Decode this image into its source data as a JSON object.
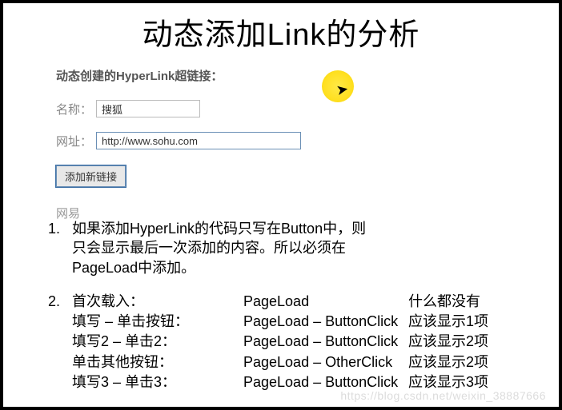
{
  "title": "动态添加Link的分析",
  "form": {
    "heading": "动态创建的HyperLink超链接：",
    "name_label": "名称：",
    "name_value": "搜狐",
    "url_label": "网址：",
    "url_value": "http://www.sohu.com",
    "add_button": "添加新链接",
    "existing_link": "网易"
  },
  "notes": {
    "item1_num": "1.",
    "item1_text": "如果添加HyperLink的代码只写在Button中，则只会显示最后一次添加的内容。所以必须在PageLoad中添加。",
    "item2_num": "2.",
    "item2_intro": "首次载入：",
    "rows": [
      {
        "action": "首次载入：",
        "events": "PageLoad",
        "result": "什么都没有"
      },
      {
        "action": "填写 – 单击按钮：",
        "events": "PageLoad – ButtonClick",
        "result": "应该显示1项"
      },
      {
        "action": "填写2 – 单击2：",
        "events": "PageLoad – ButtonClick",
        "result": "应该显示2项"
      },
      {
        "action": "单击其他按钮：",
        "events": "PageLoad – OtherClick",
        "result": "应该显示2项"
      },
      {
        "action": "填写3 – 单击3：",
        "events": "PageLoad – ButtonClick",
        "result": "应该显示3项"
      }
    ]
  },
  "watermark": "https://blog.csdn.net/weixin_38887666"
}
